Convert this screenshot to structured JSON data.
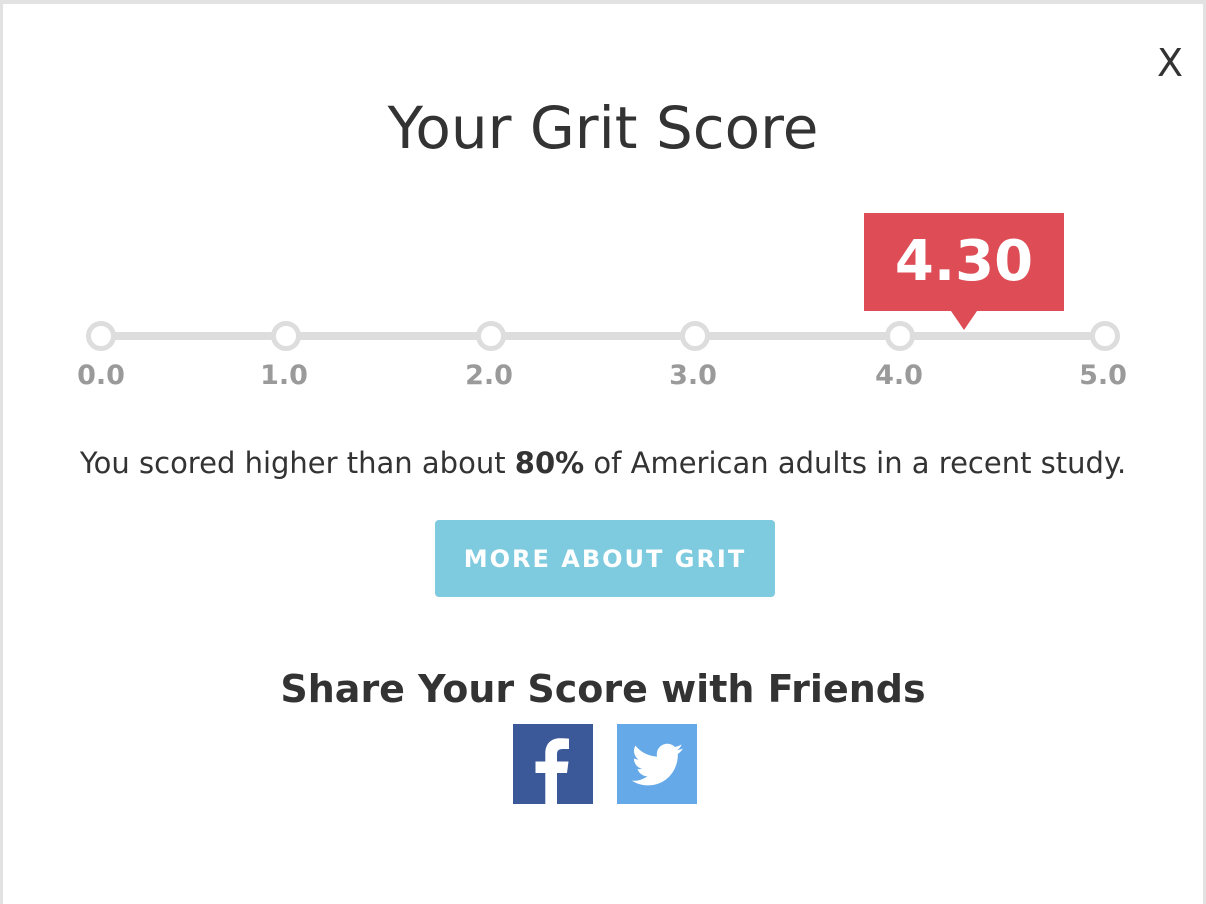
{
  "modal": {
    "close_label": "X",
    "title": "Your Grit Score"
  },
  "scale": {
    "ticks": [
      "0.0",
      "1.0",
      "2.0",
      "3.0",
      "4.0",
      "5.0"
    ],
    "min": 0,
    "max": 5,
    "score": 4.3,
    "score_label": "4.30",
    "badge_color": "#de4c55",
    "track_color": "#dddddd"
  },
  "result": {
    "prefix": "You scored higher than about ",
    "percent": "80%",
    "suffix": " of American adults in a recent study."
  },
  "more_button": {
    "label": "MORE ABOUT GRIT",
    "color": "#7ecadf"
  },
  "share": {
    "title": "Share Your Score with Friends",
    "buttons": [
      {
        "icon": "facebook-icon",
        "color": "#3b5998"
      },
      {
        "icon": "twitter-icon",
        "color": "#65a9e8"
      }
    ]
  }
}
